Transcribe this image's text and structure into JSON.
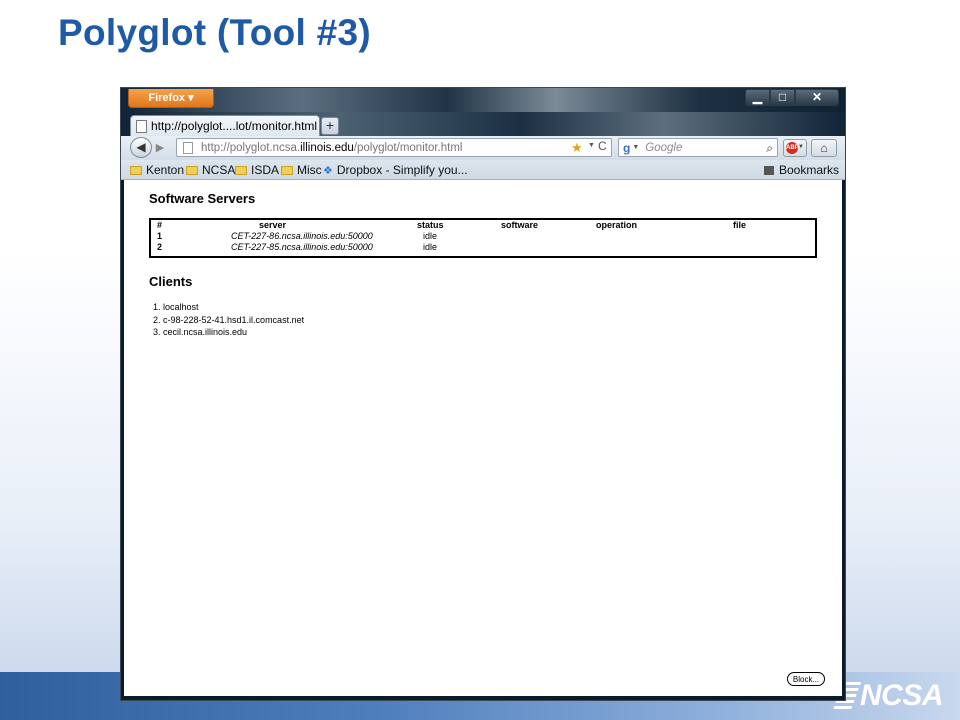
{
  "slide": {
    "title": "Polyglot (Tool #3)"
  },
  "logo": {
    "text": "NCSA"
  },
  "browser": {
    "menu_button": "Firefox ▾",
    "window_controls": {
      "minimize": "▁",
      "maximize": "□",
      "close": "✕"
    },
    "tab": {
      "title": "http://polyglot....lot/monitor.html",
      "new_tab": "+"
    },
    "nav": {
      "back": "◀",
      "forward": "▶",
      "url_prefix": "http://polyglot.ncsa.",
      "url_host": "illinois.edu",
      "url_path": "/polyglot/monitor.html",
      "star": "★",
      "dropdown": "▼",
      "reload": "C",
      "search_engine_icon": "g",
      "search_placeholder": "Google",
      "search_button": "⌕",
      "abp_label": "ABP",
      "home": "⌂"
    },
    "bookmarks": {
      "items": [
        "Kenton",
        "NCSA",
        "ISDA",
        "Misc",
        "Dropbox - Simplify you..."
      ],
      "dropbox_icon": "❖",
      "right_label": "Bookmarks"
    }
  },
  "page": {
    "servers_heading": "Software Servers",
    "columns": [
      "#",
      "server",
      "status",
      "software",
      "operation",
      "file"
    ],
    "servers": [
      {
        "num": "1",
        "server": "CET-227-86.ncsa.illinois.edu:50000",
        "status": "idle",
        "software": "",
        "operation": "",
        "file": ""
      },
      {
        "num": "2",
        "server": "CET-227-85.ncsa.illinois.edu:50000",
        "status": "idle",
        "software": "",
        "operation": "",
        "file": ""
      }
    ],
    "clients_heading": "Clients",
    "clients": [
      "1. localhost",
      "2. c-98-228-52-41.hsd1.il.comcast.net",
      "3. cecil.ncsa.illinois.edu"
    ],
    "block_button": "Block..."
  }
}
